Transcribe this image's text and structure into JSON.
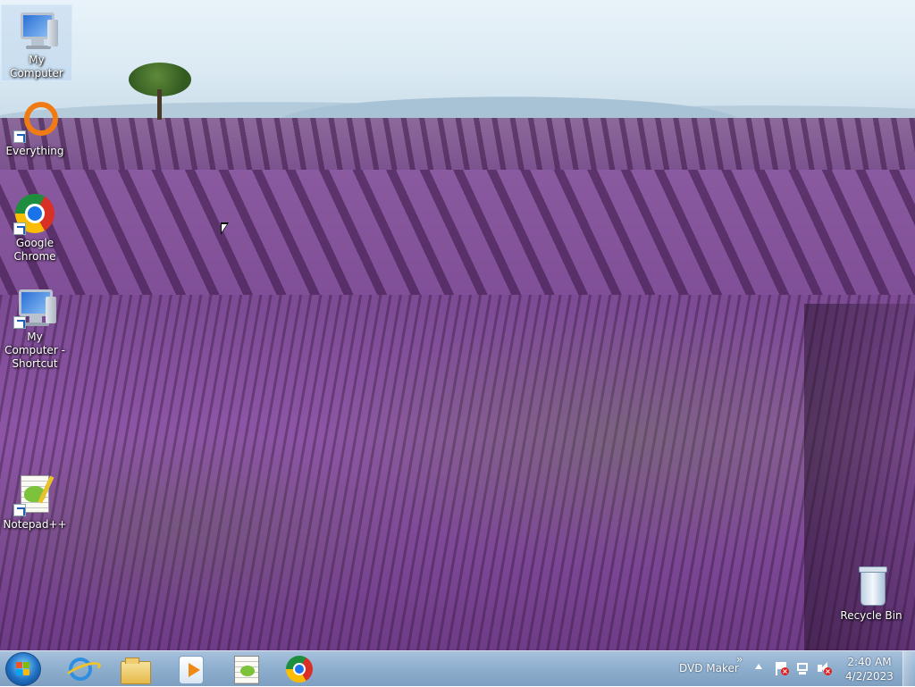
{
  "desktop": {
    "icons": [
      {
        "label": "My Computer",
        "selected": true
      },
      {
        "label": "Everything"
      },
      {
        "label": "Google Chrome"
      },
      {
        "label": "My Computer - Shortcut"
      },
      {
        "label": "Notepad++"
      },
      {
        "label": "Recycle Bin"
      }
    ]
  },
  "taskbar": {
    "pinned": [
      {
        "name": "Internet Explorer"
      },
      {
        "name": "Windows Explorer"
      },
      {
        "name": "Windows Media Player"
      },
      {
        "name": "Notepad++"
      },
      {
        "name": "Google Chrome"
      }
    ],
    "toolbar_label": "DVD Maker",
    "toolbar_chevron": "»",
    "clock": {
      "time": "2:40 AM",
      "date": "4/2/2023"
    }
  },
  "colors": {
    "taskbar": "#8fb0cf",
    "start_orb": "#1f6fc2",
    "lavender": "#7b4a93"
  }
}
